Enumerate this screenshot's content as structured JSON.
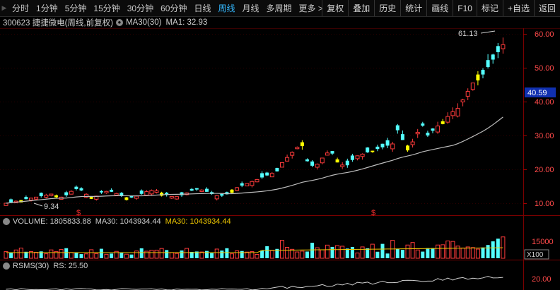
{
  "toolbar": {
    "periods": [
      "分时",
      "1分钟",
      "5分钟",
      "15分钟",
      "30分钟",
      "60分钟",
      "日线",
      "周线",
      "月线",
      "多周期",
      "更多 >"
    ],
    "active_index": 7,
    "buttons": [
      "复权",
      "叠加",
      "历史",
      "统计",
      "画线",
      "F10",
      "标记",
      "+自选",
      "返回"
    ]
  },
  "info": {
    "code_name": "300623 捷捷微电(周线,前复权)",
    "ma_label": "MA30(30)",
    "ma1": "MA1: 32.93"
  },
  "price_axis": {
    "ticks": [
      "60.00",
      "50.00",
      "40.00",
      "30.00",
      "20.00",
      "10.00"
    ],
    "current": "40.59",
    "high_label": "61.13",
    "low_label": "9.34",
    "marker": "$"
  },
  "volume": {
    "label": "VOLUME: 1805833.88",
    "ma30_white": "MA30: 1043934.44",
    "ma30_yellow": "MA30: 1043934.44",
    "tick": "15000",
    "unit": "X100"
  },
  "rs": {
    "label": "RSMS(30)",
    "value": "RS: 25.50",
    "tick": "20.00"
  },
  "colors": {
    "up": "#ff3b3b",
    "down": "#54ffff",
    "yellow": "#ffff00",
    "ma": "#c0c0c0",
    "vol_ma": "#f0c800"
  }
}
